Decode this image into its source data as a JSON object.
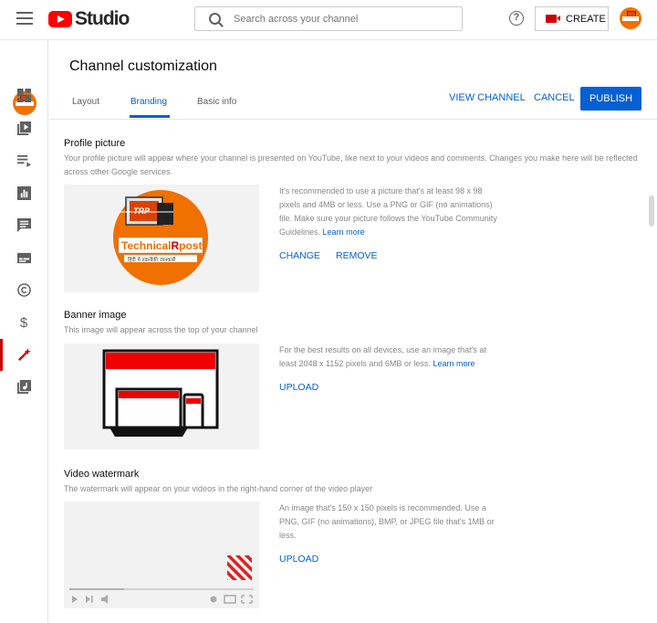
{
  "app": {
    "logo_text": "Studio",
    "search_placeholder": "Search across your channel",
    "create_label": "CREATE"
  },
  "sidebar": {
    "items": [
      {
        "icon": "dashboard-icon"
      },
      {
        "icon": "content-icon"
      },
      {
        "icon": "playlists-icon"
      },
      {
        "icon": "analytics-icon"
      },
      {
        "icon": "comments-icon"
      },
      {
        "icon": "subtitles-icon"
      },
      {
        "icon": "copyright-icon"
      },
      {
        "icon": "earn-icon"
      },
      {
        "icon": "customization-icon",
        "active": true
      },
      {
        "icon": "audio-library-icon"
      }
    ]
  },
  "header": {
    "title": "Channel customization",
    "tabs": [
      {
        "label": "Layout"
      },
      {
        "label": "Branding",
        "active": true
      },
      {
        "label": "Basic info"
      }
    ],
    "view_channel": "VIEW CHANNEL",
    "cancel": "CANCEL",
    "publish": "PUBLISH"
  },
  "profile": {
    "title": "Profile picture",
    "description": "Your profile picture will appear where your channel is presented on YouTube, like next to your videos and comments. Changes you make here will be reflected across other Google services.",
    "info": "It's recommended to use a picture that's at least 98 x 98 pixels and 4MB or less. Use a PNG or GIF (no animations) file. Make sure your picture follows the YouTube Community Guidelines.",
    "learn_more": "Learn more",
    "change": "CHANGE",
    "remove": "REMOVE",
    "logo_top": "TRP",
    "logo_name_a": "Technical",
    "logo_name_b": "R",
    "logo_name_c": "post",
    "logo_tagline": "हिंदी में तकनीकी जानकारी"
  },
  "banner": {
    "title": "Banner image",
    "description": "This image will appear across the top of your channel",
    "info": "For the best results on all devices, use an image that's at least 2048 x 1152 pixels and 6MB or less.",
    "learn_more": "Learn more",
    "upload": "UPLOAD"
  },
  "watermark": {
    "title": "Video watermark",
    "description": "The watermark will appear on your videos in the right-hand corner of the video player",
    "info": "An image that's 150 x 150 pixels is recommended. Use a PNG, GIF (no animations), BMP, or JPEG file that's 1MB or less.",
    "upload": "UPLOAD"
  },
  "colors": {
    "accent": "#065fd4",
    "brand_red": "#ff0000",
    "logo_orange": "#f07000"
  }
}
